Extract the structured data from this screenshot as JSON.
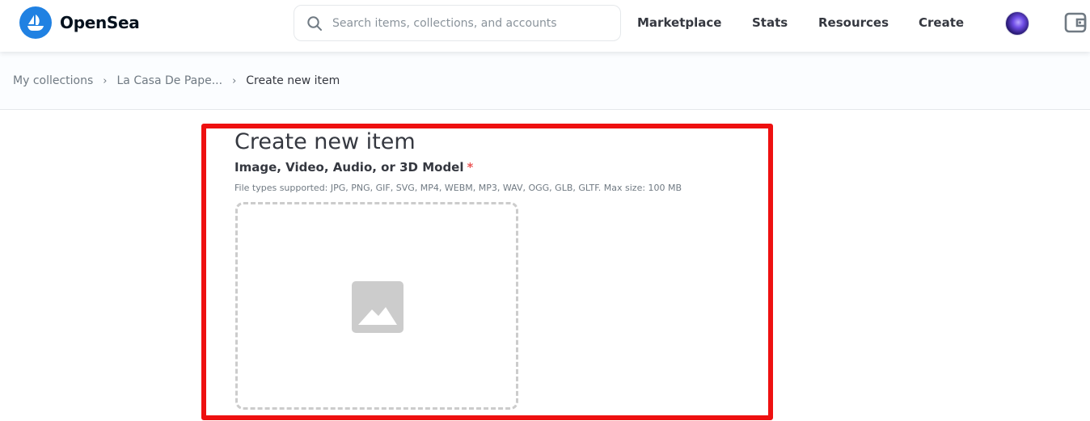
{
  "header": {
    "brand": "OpenSea",
    "search_placeholder": "Search items, collections, and accounts",
    "nav": [
      "Marketplace",
      "Stats",
      "Resources",
      "Create"
    ]
  },
  "breadcrumb": {
    "items": [
      "My collections",
      "La Casa De Pape..."
    ],
    "current": "Create new item",
    "separator": "›"
  },
  "form": {
    "title": "Create new item",
    "media_label": "Image, Video, Audio, or 3D Model",
    "required_mark": "*",
    "file_types_help": "File types supported: JPG, PNG, GIF, SVG, MP4, WEBM, MP3, WAV, OGG, GLB, GLTF. Max size: 100 MB",
    "dropzone_icon": "image-placeholder-icon"
  },
  "colors": {
    "brand": "#2081e2",
    "highlight_border": "#ee1010",
    "required": "#eb5757",
    "text": "#353840",
    "muted": "#707a83"
  }
}
